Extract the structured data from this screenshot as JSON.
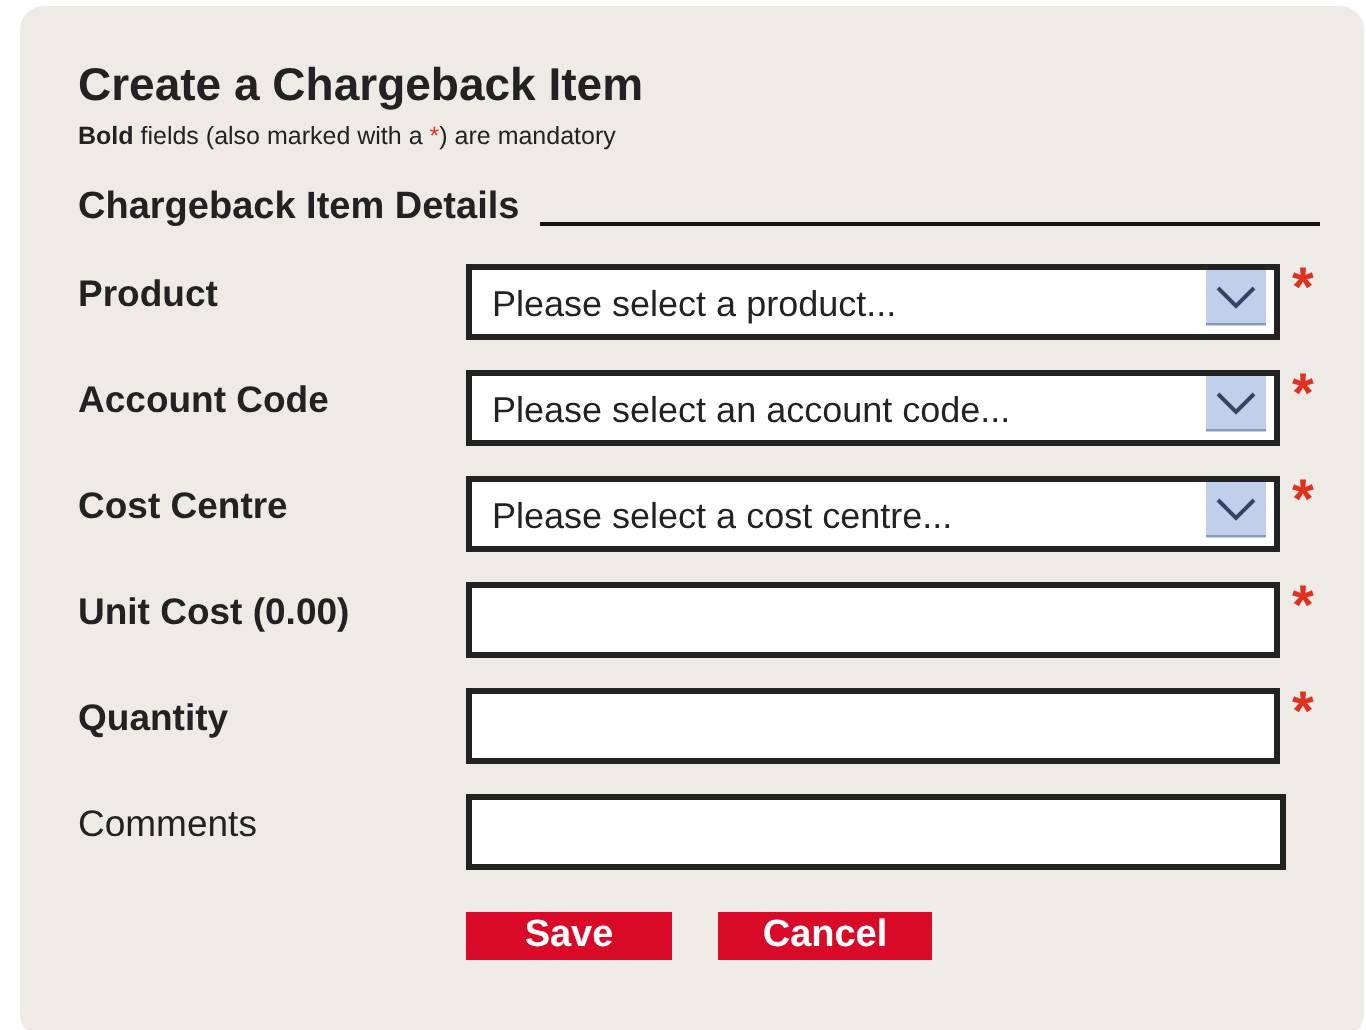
{
  "title": "Create a Chargeback Item",
  "legend": {
    "before": "**Bold** fields (also marked with a ",
    "mark": "*",
    "after": ") are mandatory"
  },
  "section": {
    "title": "Chargeback Item Details"
  },
  "fields": [
    {
      "label": "Product",
      "kind": "select",
      "mandatory": true,
      "mark": "*",
      "placeholder": "Please select a product..."
    },
    {
      "label": "Account Code",
      "kind": "select",
      "mandatory": true,
      "mark": "*",
      "placeholder": "Please select an account code..."
    },
    {
      "label": "Cost Centre",
      "kind": "select",
      "mandatory": true,
      "mark": "*",
      "placeholder": "Please select a cost centre..."
    },
    {
      "label": "Unit Cost (0.00)",
      "kind": "text",
      "mandatory": true,
      "mark": "*"
    },
    {
      "label": "Quantity",
      "kind": "text",
      "mandatory": true,
      "mark": "*"
    },
    {
      "label": "Comments",
      "kind": "text",
      "mandatory": false
    }
  ],
  "buttons": [
    "Save",
    "Cancel"
  ]
}
